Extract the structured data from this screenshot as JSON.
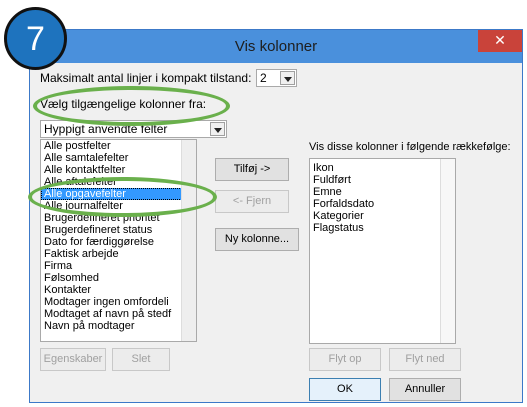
{
  "step_badge": "7",
  "dialog": {
    "title": "Vis kolonner",
    "close_glyph": "✕",
    "max_lines_label": "Maksimalt antal linjer i kompakt tilstand:",
    "max_lines_value": "2",
    "choose_from_label": "Vælg tilgængelige kolonner fra:",
    "source_combo_value": "Hyppigt anvendte felter",
    "available_columns": [
      "Alle postfelter",
      "Alle samtalefelter",
      "Alle kontaktfelter",
      "Alle aftalefelter",
      "Alle opgavefelter",
      "Alle journalfelter",
      "Brugerdefineret prioritet",
      "Brugerdefineret status",
      "Dato for færdiggørelse",
      "Faktisk arbejde",
      "Firma",
      "Følsomhed",
      "Kontakter",
      "Modtager ingen omfordeli",
      "Modtaget af navn på stedf",
      "Navn på modtager"
    ],
    "selected_available_index": 4,
    "add_button": "Tilføj ->",
    "remove_button": "<- Fjern",
    "new_column_button": "Ny kolonne...",
    "shown_columns_label": "Vis disse kolonner i følgende rækkefølge:",
    "shown_columns": [
      "Ikon",
      "Fuldført",
      "Emne",
      "Forfaldsdato",
      "Kategorier",
      "Flagstatus"
    ],
    "properties_button": "Egenskaber",
    "delete_button": "Slet",
    "move_up_button": "Flyt op",
    "move_down_button": "Flyt ned",
    "ok_button": "OK",
    "cancel_button": "Annuller"
  },
  "colors": {
    "title_bar": "#4a90dc",
    "close_button": "#c9433a",
    "badge": "#1e73be",
    "highlight_ring": "#6ab04c",
    "selection": "#3399ff"
  }
}
